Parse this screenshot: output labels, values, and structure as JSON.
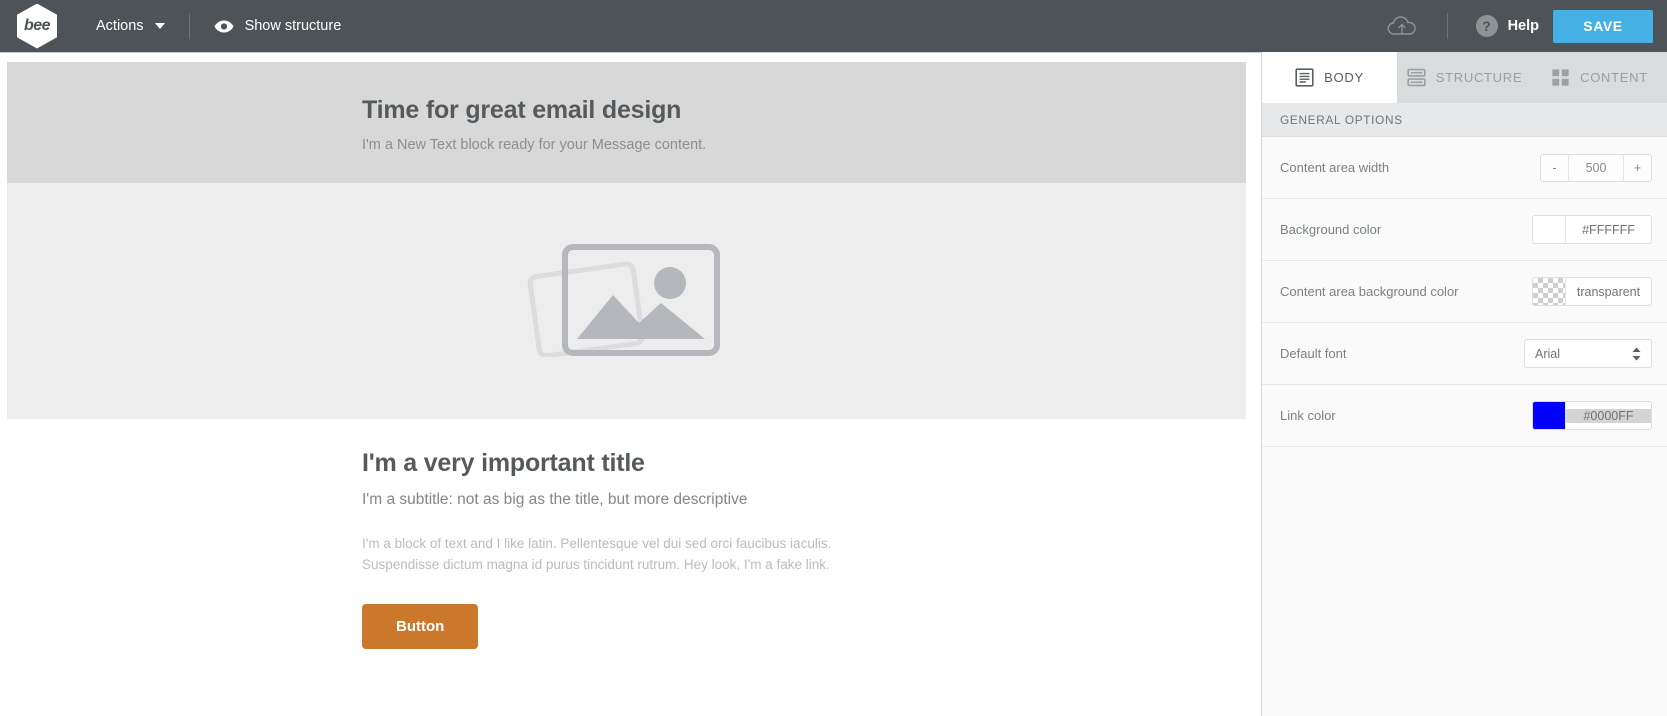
{
  "topbar": {
    "logo_text": "bee",
    "actions_label": "Actions",
    "show_structure_label": "Show structure",
    "help_label": "Help",
    "help_glyph": "?",
    "save_label": "SAVE",
    "save_color": "#45b0e3",
    "background_color": "#4d5356"
  },
  "canvas": {
    "row1": {
      "heading": "Time for great email design",
      "subtext": "I'm a New Text block ready for your Message content.",
      "background_color": "#d8d8d8"
    },
    "row2": {
      "background_color": "#ededed",
      "placeholder_alt": "image-placeholder"
    },
    "row3": {
      "title": "I'm a very important title",
      "subtitle": "I'm a subtitle: not as big as the title, but more descriptive",
      "body": "I'm a block of text and I like latin. Pellentesque vel dui sed orci faucibus iaculis. Suspendisse dictum magna id purus tincidunt rutrum. Hey look, I'm a fake link.",
      "button_label": "Button",
      "button_color": "#cb782c",
      "background_color": "#ffffff"
    }
  },
  "panel": {
    "tabs": [
      {
        "label": "BODY",
        "icon": "document-icon",
        "active": true
      },
      {
        "label": "STRUCTURE",
        "icon": "rows-icon",
        "active": false
      },
      {
        "label": "CONTENT",
        "icon": "grid-icon",
        "active": false
      }
    ],
    "section_title": "GENERAL OPTIONS",
    "options": {
      "content_area_width": {
        "label": "Content area width",
        "minus": "-",
        "value": "500",
        "plus": "+"
      },
      "background_color": {
        "label": "Background color",
        "value": "#FFFFFF",
        "swatch": "#FFFFFF"
      },
      "content_area_background_color": {
        "label": "Content area background color",
        "value": "transparent",
        "swatch": "transparent"
      },
      "default_font": {
        "label": "Default font",
        "value": "Arial"
      },
      "link_color": {
        "label": "Link color",
        "value": "#0000FF",
        "swatch": "#0000FF"
      }
    }
  }
}
